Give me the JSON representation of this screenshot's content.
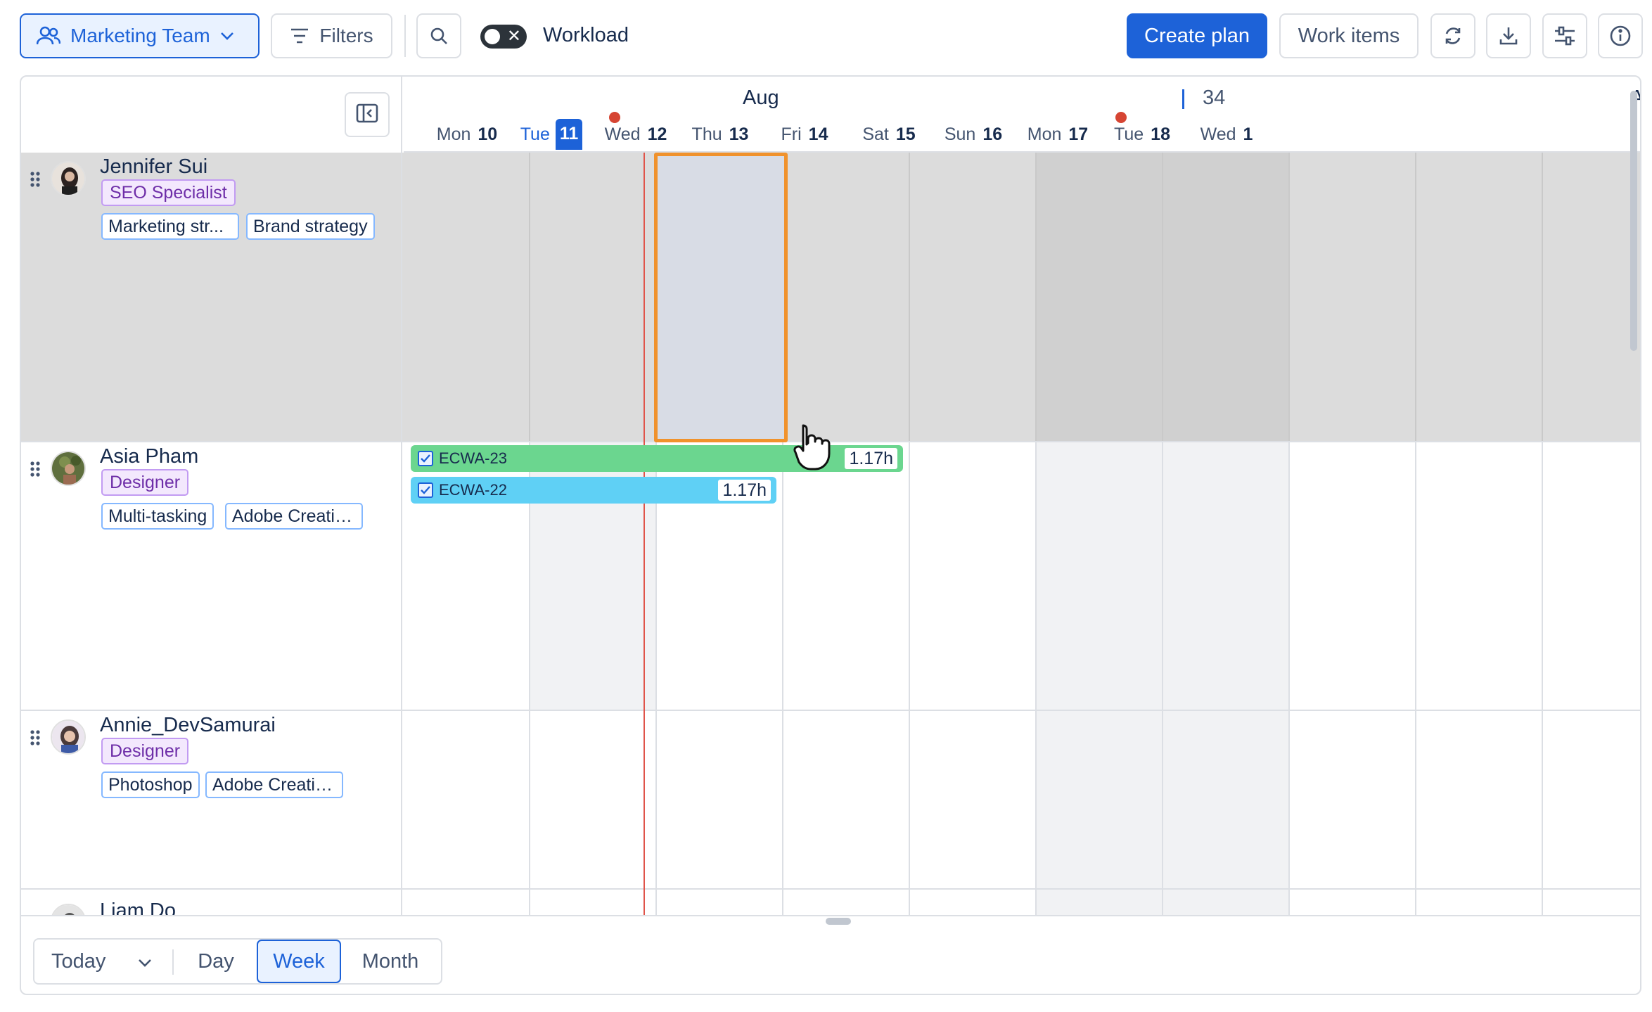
{
  "toolbar": {
    "team_label": "Marketing Team",
    "filters_label": "Filters",
    "workload_label": "Workload",
    "create_plan_label": "Create plan",
    "work_items_label": "Work items"
  },
  "timeline": {
    "month_label": "Aug",
    "next_month_partial": "Au",
    "week_number": "34",
    "days": [
      {
        "dow": "Mon",
        "num": "10"
      },
      {
        "dow": "Tue",
        "num": "11"
      },
      {
        "dow": "Wed",
        "num": "12"
      },
      {
        "dow": "Thu",
        "num": "13"
      },
      {
        "dow": "Fri",
        "num": "14"
      },
      {
        "dow": "Sat",
        "num": "15"
      },
      {
        "dow": "Sun",
        "num": "16"
      },
      {
        "dow": "Mon",
        "num": "17"
      },
      {
        "dow": "Tue",
        "num": "18"
      },
      {
        "dow": "Wed",
        "num": "1"
      }
    ]
  },
  "members": [
    {
      "name": "Jennifer Sui",
      "role": "SEO Specialist",
      "skills": [
        "Marketing str...",
        "Brand strategy"
      ]
    },
    {
      "name": "Asia Pham",
      "role": "Designer",
      "skills": [
        "Multi-tasking",
        "Adobe Creativ..."
      ]
    },
    {
      "name": "Annie_DevSamurai",
      "role": "Designer",
      "skills": [
        "Photoshop",
        "Adobe Creativ..."
      ]
    },
    {
      "name": "Liam Do"
    }
  ],
  "tasks": [
    {
      "key": "ECWA-23",
      "hours": "1.17h",
      "color": "#6bd68f"
    },
    {
      "key": "ECWA-22",
      "hours": "1.17h",
      "color": "#5fd0f5"
    }
  ],
  "view_switch": {
    "today": "Today",
    "day": "Day",
    "week": "Week",
    "month": "Month",
    "selected": "Week"
  },
  "colors": {
    "accent": "#1d62d8",
    "today_line": "#e0544a",
    "selection_border": "#f0922c"
  }
}
